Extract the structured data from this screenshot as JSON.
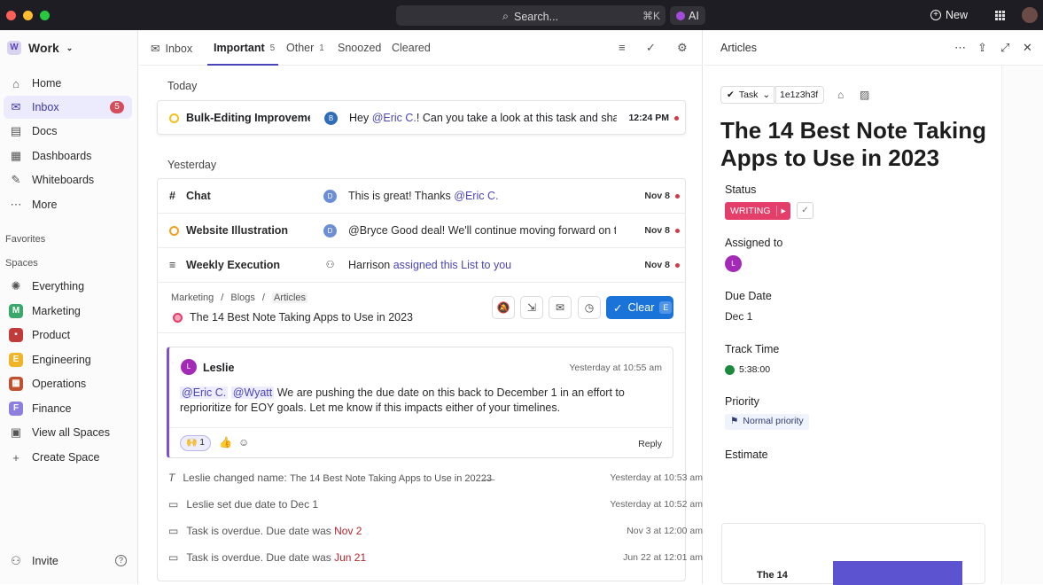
{
  "topbar": {
    "search_label": "Search...",
    "search_shortcut": "⌘K",
    "ai_label": "AI",
    "new_label": "New"
  },
  "sidebar": {
    "workspace": "Work",
    "nav": [
      {
        "label": "Home",
        "icon": "home-icon"
      },
      {
        "label": "Inbox",
        "icon": "inbox-icon",
        "badge": "5"
      },
      {
        "label": "Docs",
        "icon": "doc-icon"
      },
      {
        "label": "Dashboards",
        "icon": "dashboard-icon"
      },
      {
        "label": "Whiteboards",
        "icon": "whiteboard-icon"
      },
      {
        "label": "More",
        "icon": "more-icon"
      }
    ],
    "favorites_label": "Favorites",
    "spaces_label": "Spaces",
    "spaces": [
      {
        "label": "Everything",
        "letter": ""
      },
      {
        "label": "Marketing",
        "letter": "M",
        "color": "#3aa86b"
      },
      {
        "label": "Product",
        "letter": "",
        "color": "#c23b3b"
      },
      {
        "label": "Engineering",
        "letter": "E",
        "color": "#f0b429"
      },
      {
        "label": "Operations",
        "letter": "",
        "color": "#c1502e"
      },
      {
        "label": "Finance",
        "letter": "F",
        "color": "#8d7fe0"
      },
      {
        "label": "View all Spaces",
        "letter": ""
      },
      {
        "label": "Create Space",
        "letter": ""
      }
    ],
    "invite_label": "Invite"
  },
  "inbox": {
    "inbox_label": "Inbox",
    "tabs": [
      {
        "label": "Important",
        "count": "5"
      },
      {
        "label": "Other",
        "count": "1"
      },
      {
        "label": "Snoozed",
        "count": ""
      },
      {
        "label": "Cleared",
        "count": ""
      }
    ],
    "today_label": "Today",
    "yesterday_label": "Yesterday",
    "today_item": {
      "title": "Bulk-Editing Improvement",
      "avatar": "B",
      "msg_prefix": "Hey ",
      "mention": "@Eric C.",
      "msg_suffix": "! Can you take a look at this task and share y",
      "time": "12:24 PM"
    },
    "rows": [
      {
        "title": "Chat",
        "avatar": "D",
        "msg": "This is great! Thanks ",
        "mention": "@Eric C.",
        "date": "Nov 8"
      },
      {
        "title": "Website Illustration",
        "avatar": "D",
        "msg": "@Bryce Good deal! We'll continue moving forward on this",
        "mention": "",
        "date": "Nov 8"
      },
      {
        "title": "Weekly Execution",
        "avatar": "",
        "msg": "Harrison ",
        "mention": "assigned this List to you",
        "date": "Nov 8"
      }
    ],
    "open_item": {
      "breadcrumb": [
        "Marketing",
        "/",
        "Blogs",
        "/",
        "Articles"
      ],
      "title": "The 14 Best Note Taking Apps to Use in 2023",
      "clear_label": "Clear",
      "clear_key": "E"
    },
    "comment": {
      "avatar": "L",
      "author": "Leslie",
      "time": "Yesterday at 10:55 am",
      "mention1": "@Eric C.",
      "mention2": "@Wyatt",
      "text": " We are pushing the due date on this back to December 1 in an effort to reprioritize for EOY goals. Let me know if this impacts either of your timelines.",
      "reaction_count": "1",
      "reply_label": "Reply"
    },
    "activity": [
      {
        "text": "Leslie changed name: ",
        "extra": "The 14 Best Note Taking Apps to Use in 2022̶3̶",
        "time": "Yesterday at 10:53 am"
      },
      {
        "text": "Leslie set due date to Dec 1",
        "extra": "",
        "time": "Yesterday at 10:52 am"
      },
      {
        "text": "Task is overdue. Due date was ",
        "extra": "Nov 2",
        "time": "Nov 3 at 12:00 am"
      },
      {
        "text": "Task is overdue. Due date was ",
        "extra": "Jun 21",
        "time": "Jun 22 at 12:01 am"
      }
    ]
  },
  "panel": {
    "title": "Articles",
    "task_type": "Task",
    "task_id": "1e1z3h3f",
    "heading": "The 14 Best Note Taking Apps to Use in 2023",
    "status_label": "Status",
    "status_value": "WRITING",
    "assigned_label": "Assigned to",
    "assignee": "L",
    "due_label": "Due Date",
    "due_value": "Dec 1",
    "track_label": "Track Time",
    "track_value": "5:38:00",
    "priority_label": "Priority",
    "priority_value": "Normal priority",
    "estimate_label": "Estimate",
    "thumb_text": "The 14"
  },
  "colors": {
    "accent": "#4a46b8",
    "status": "#e43e6a",
    "clear_button": "#1a73d9"
  }
}
